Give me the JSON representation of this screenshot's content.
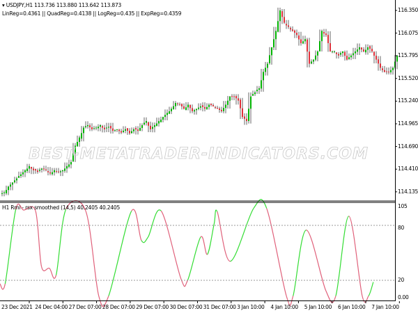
{
  "main": {
    "symbol_line": "USDJPY,H1  113.736 113.880 113.642 113.873",
    "regression_line": "LinReg=0.4361 || QuadReg=0.4138 || LogReg=0.435 || ExpReg=0.4359",
    "watermark": "BEST-METATRADER-INDICATORS.COM",
    "price_axis": [
      "116.350",
      "116.075",
      "115.795",
      "115.520",
      "115.240",
      "114.965",
      "114.690",
      "114.410",
      "114.135"
    ],
    "price_range": [
      114.135,
      116.35
    ],
    "closes": [
      114.13,
      114.2,
      114.25,
      114.3,
      114.35,
      114.4,
      114.45,
      114.4,
      114.38,
      114.42,
      114.4,
      114.36,
      114.4,
      114.38,
      114.4,
      114.45,
      114.5,
      114.7,
      114.8,
      114.92,
      114.95,
      114.9,
      114.92,
      114.95,
      114.9,
      114.93,
      114.88,
      114.9,
      114.86,
      114.9,
      114.85,
      114.9,
      114.88,
      114.95,
      115.0,
      114.9,
      114.95,
      115.0,
      115.05,
      115.1,
      115.15,
      115.22,
      115.2,
      115.15,
      115.2,
      115.12,
      115.15,
      115.18,
      115.15,
      115.2,
      115.18,
      115.15,
      115.12,
      115.2,
      115.3,
      115.3,
      115.25,
      115.05,
      115.0,
      115.3,
      115.35,
      115.4,
      115.6,
      115.7,
      115.9,
      116.1,
      116.35,
      116.2,
      116.15,
      116.1,
      116.05,
      115.95,
      116.0,
      115.7,
      115.75,
      115.85,
      116.1,
      116.05,
      115.85,
      115.85,
      115.8,
      115.85,
      115.75,
      115.8,
      115.85,
      115.9,
      115.85,
      115.9,
      115.85,
      115.75,
      115.65,
      115.6,
      115.6,
      115.65,
      115.8
    ]
  },
  "indicator": {
    "title": "H1 Rmi - rsx smoothed (14,5) 40.2405 40.2405",
    "axis": [
      "105",
      "80",
      "20",
      "0.00"
    ],
    "levels": [
      80,
      20
    ],
    "rmi_points": [
      [
        0,
        16
      ],
      [
        1.3,
        16
      ],
      [
        4,
        102
      ],
      [
        6,
        101
      ],
      [
        9,
        100
      ],
      [
        10.5,
        36
      ],
      [
        12.5,
        34
      ],
      [
        14.2,
        26
      ],
      [
        16.7,
        102
      ],
      [
        21.7,
        100
      ],
      [
        25,
        2
      ],
      [
        27.5,
        2
      ],
      [
        33.3,
        100
      ],
      [
        35.8,
        66
      ],
      [
        37.5,
        70
      ],
      [
        40.8,
        100
      ],
      [
        45.8,
        22
      ],
      [
        47.5,
        20
      ],
      [
        50.8,
        70
      ],
      [
        52.5,
        50
      ],
      [
        54.2,
        85
      ],
      [
        55,
        99
      ],
      [
        58.3,
        42
      ],
      [
        64.2,
        103
      ],
      [
        67.5,
        103
      ],
      [
        72.5,
        2
      ],
      [
        74.2,
        2
      ],
      [
        77.5,
        78
      ],
      [
        82.5,
        8
      ],
      [
        85,
        2
      ],
      [
        88.3,
        94
      ],
      [
        91.7,
        2
      ],
      [
        93.3,
        2
      ],
      [
        94.5,
        18
      ]
    ]
  },
  "time_axis": [
    "23 Dec 2021",
    "24 Dec 04:00",
    "27 Dec 07:00",
    "28 Dec 07:00",
    "29 Dec 07:00",
    "30 Dec 07:00",
    "31 Dec 07:00",
    "3 Jan 10:00",
    "4 Jan 10:00",
    "5 Jan 10:00",
    "6 Jan 10:00",
    "7 Jan 10:00"
  ],
  "colors": {
    "bull": "#00b300",
    "bear": "#e0303a",
    "rmi_up": "#33dd33",
    "rmi_down": "#e0607a",
    "grid": "#999999"
  }
}
